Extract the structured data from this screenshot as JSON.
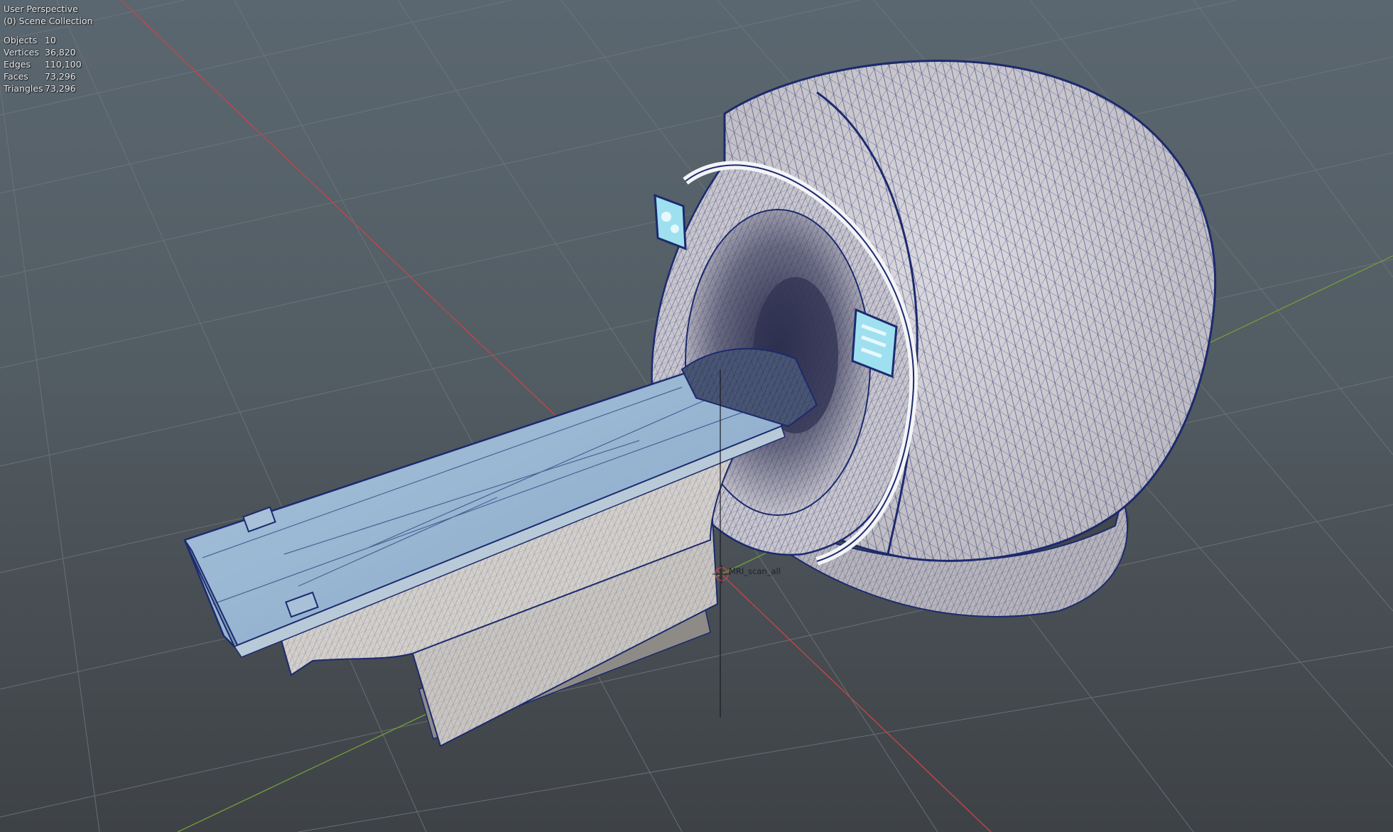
{
  "viewport": {
    "perspective_label": "User Perspective",
    "collection_label": "(0) Scene Collection",
    "stats": [
      {
        "label": "Objects",
        "value": "10"
      },
      {
        "label": "Vertices",
        "value": "36,820"
      },
      {
        "label": "Edges",
        "value": "110,100"
      },
      {
        "label": "Faces",
        "value": "73,296"
      },
      {
        "label": "Triangles",
        "value": "73,296"
      }
    ],
    "active_object_name": "MRI_scan_all"
  },
  "colors": {
    "background_top": "#5b6770",
    "background_bottom": "#3e4246",
    "grid_line": "#6e767c",
    "x_axis": "#c0464a",
    "y_axis": "#6f9a3a",
    "wireframe": "#1c2a6e",
    "shell": "#cfccd2",
    "table_top": "#9ab7d3",
    "screen": "#8fd6ea"
  },
  "icons": [
    "object-origin-icon",
    "3d-cursor-icon"
  ]
}
